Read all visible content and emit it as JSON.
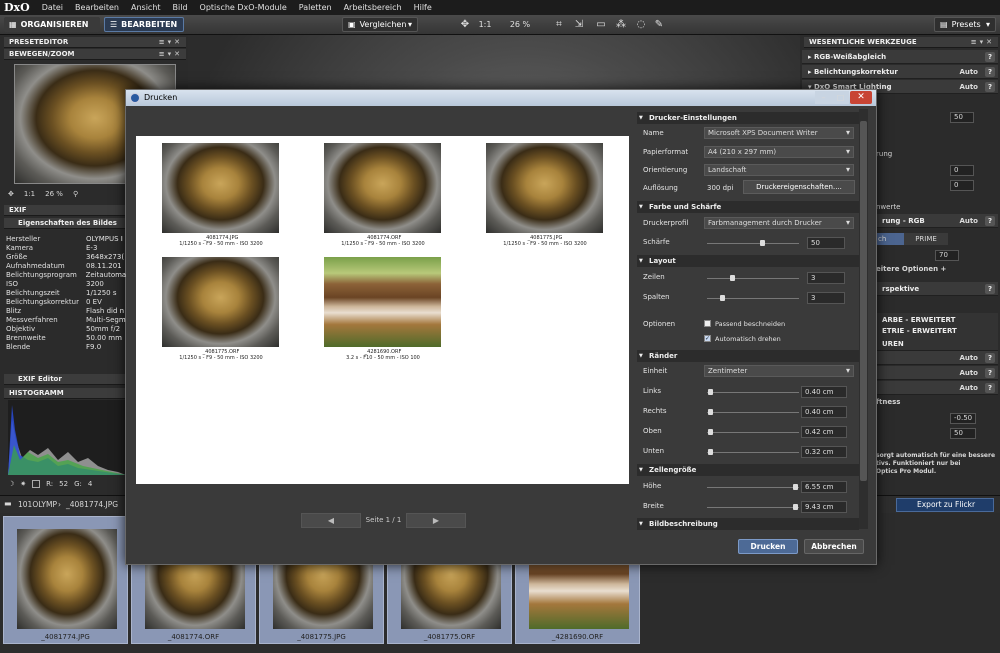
{
  "menubar": {
    "logo": "DxO",
    "items": [
      "Datei",
      "Bearbeiten",
      "Ansicht",
      "Bild",
      "Optische DxO-Module",
      "Paletten",
      "Arbeitsbereich",
      "Hilfe"
    ]
  },
  "toolbar": {
    "organize": "ORGANISIEREN",
    "edit": "BEARBEITEN",
    "compare": "Vergleichen",
    "zoom_fit": "1:1",
    "zoom": "26 %",
    "presets": "Presets"
  },
  "left": {
    "preset_editor": "PRESETEDITOR",
    "move_zoom": "BEWEGEN/ZOOM",
    "nav_zoom_fit": "1:1",
    "nav_zoom": "26 %",
    "exif": "EXIF",
    "image_props": "Eigenschaften des Bildes",
    "exif_rows": [
      {
        "k": "Hersteller",
        "v": "OLYMPUS I"
      },
      {
        "k": "Kamera",
        "v": "E-3"
      },
      {
        "k": "Größe",
        "v": "3648x273("
      },
      {
        "k": "Aufnahmedatum",
        "v": "08.11.201"
      },
      {
        "k": "Belichtungsprogram",
        "v": "Zeitautoma"
      },
      {
        "k": "ISO",
        "v": "3200"
      },
      {
        "k": "Belichtungszeit",
        "v": "1/1250 s"
      },
      {
        "k": "Belichtungskorrektur",
        "v": "0 EV"
      },
      {
        "k": "Blitz",
        "v": "Flash did n"
      },
      {
        "k": "Messverfahren",
        "v": "Multi-Segm"
      },
      {
        "k": "Objektiv",
        "v": "50mm f/2"
      },
      {
        "k": "Brennweite",
        "v": "50.00 mm"
      },
      {
        "k": "Blende",
        "v": "F9.0"
      }
    ],
    "exif_editor": "EXIF Editor",
    "histogram": "HISTOGRAMM",
    "hist_r": "R:",
    "hist_r_val": "52",
    "hist_g": "G:",
    "hist_g_val": "4"
  },
  "right": {
    "essential_tools": "WESENTLICHE WERKZEUGE",
    "rows": [
      {
        "label": "RGB-Weißabgleich",
        "auto": ""
      },
      {
        "label": "Belichtungskorrektur",
        "auto": "Auto"
      },
      {
        "label": "DxO Smart Lighting",
        "auto": "Auto"
      }
    ],
    "v50a": "50",
    "v0a": "0",
    "v0b": "0",
    "rgb_auto": "Auto",
    "fragment_rung": "rung",
    "fragment_werte": "nwerte",
    "fragment_rgb": "rung - RGB",
    "tab_prime": "PRIME",
    "tab_ch": "ch",
    "v70": "70",
    "more_options": "eitere Optionen +",
    "perspective": "rspektive",
    "farbe": "ARBE - ERWEITERT",
    "metrie": "ETRIE - ERWEITERT",
    "uren": "UREN",
    "auto1": "Auto",
    "auto2": "Auto",
    "auto3": "Auto",
    "ftness": "ftness",
    "vneg": "-0.50",
    "v50b": "50",
    "note1": "sorgt automatisch für eine bessere",
    "note2": "tivs. Funktioniert nur bei",
    "note3": "Optics Pro Modul.",
    "export": "Export zu Flickr"
  },
  "strip": {
    "folder": "101OLYMP",
    "file": "_4081774.JPG",
    "thumbs": [
      "_4081774.JPG",
      "_4081774.ORF",
      "_4081775.JPG",
      "_4081775.ORF",
      "_4281690.ORF"
    ]
  },
  "dialog": {
    "title": "Drucken",
    "preview_items": [
      {
        "name": "_4081774.JPG",
        "info": "1/1250 s - F9 - 50 mm - ISO 3200"
      },
      {
        "name": "_4081774.ORF",
        "info": "1/1250 s - F9 - 50 mm - ISO 3200"
      },
      {
        "name": "_4081775.JPG",
        "info": "1/1250 s - F9 - 50 mm - ISO 3200"
      },
      {
        "name": "_4081775.ORF",
        "info": "1/1250 s - F9 - 50 mm - ISO 3200"
      },
      {
        "name": "_4281690.ORF",
        "info": "3.2 s - F10 - 50 mm - ISO 100"
      }
    ],
    "page": "Seite 1 / 1",
    "printer_section": "Drucker-Einstellungen",
    "name_label": "Name",
    "name_value": "Microsoft XPS Document Writer",
    "paper_label": "Papierformat",
    "paper_value": "A4 (210 x 297 mm)",
    "orient_label": "Orientierung",
    "orient_value": "Landschaft",
    "res_label": "Auflösung",
    "res_value": "300 dpi",
    "driver_button": "Druckereigenschaften....",
    "color_section": "Farbe und Schärfe",
    "profile_label": "Druckerprofil",
    "profile_value": "Farbmanagement durch Drucker",
    "sharp_label": "Schärfe",
    "sharp_value": "50",
    "layout_section": "Layout",
    "rows_label": "Zeilen",
    "rows_value": "3",
    "cols_label": "Spalten",
    "cols_value": "3",
    "options_label": "Optionen",
    "opt_crop": "Passend beschneiden",
    "opt_rotate": "Automatisch drehen",
    "margins_section": "Ränder",
    "unit_label": "Einheit",
    "unit_value": "Zentimeter",
    "left_label": "Links",
    "left_value": "0.40 cm",
    "right_label": "Rechts",
    "right_value": "0.40 cm",
    "top_label": "Oben",
    "top_value": "0.42 cm",
    "bottom_label": "Unten",
    "bottom_value": "0.32 cm",
    "cell_section": "Zellengröße",
    "height_label": "Höhe",
    "height_value": "6.55 cm",
    "width_label": "Breite",
    "width_value": "9.43 cm",
    "caption_section": "Bildbeschreibung",
    "print_button": "Drucken",
    "cancel_button": "Abbrechen"
  }
}
